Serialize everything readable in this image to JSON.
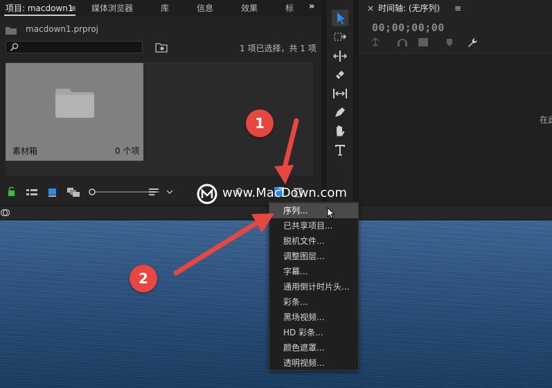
{
  "project_panel": {
    "tabs": [
      {
        "label": "项目: macdown1",
        "active": true
      },
      {
        "label": "媒体浏览器"
      },
      {
        "label": "库"
      },
      {
        "label": "信息"
      },
      {
        "label": "效果"
      },
      {
        "label": "标"
      }
    ],
    "tab_menu_glyph": "≡",
    "overflow_glyph": "»",
    "project_file": "macdown1.prproj",
    "search": {
      "value": "",
      "placeholder": ""
    },
    "selection_status": "1 项已选择，共 1 项",
    "bin": {
      "name": "素材箱",
      "count": "0 个项"
    }
  },
  "timeline_panel": {
    "close_glyph": "×",
    "title": "时间轴: (无序列)",
    "menu_glyph": "≡",
    "timecode": "00;00;00;00",
    "drop_hint": "在此"
  },
  "new_item_menu": {
    "items": [
      {
        "label": "序列...",
        "highlighted": true
      },
      {
        "label": "已共享项目..."
      },
      {
        "label": "脱机文件..."
      },
      {
        "label": "调整图层..."
      },
      {
        "label": "字幕..."
      },
      {
        "label": "通用倒计时片头..."
      },
      {
        "label": "彩条..."
      },
      {
        "label": "黑场视频..."
      },
      {
        "label": "HD 彩条..."
      },
      {
        "label": "颜色遮罩..."
      },
      {
        "label": "透明视频..."
      }
    ]
  },
  "annotations": {
    "badge_1": "1",
    "badge_2": "2",
    "watermark": "www.MacDown.com"
  },
  "colors": {
    "accent_blue": "#2d8ceb",
    "badge_red": "#e8473f",
    "lock_green": "#3bbf3b"
  },
  "icons": [
    "search-icon",
    "new-bin-icon",
    "folder-icon",
    "lock-icon",
    "list-view-icon",
    "icon-view-icon",
    "freeform-view-icon",
    "zoom-slider",
    "sort-icon",
    "find-icon",
    "new-item-icon",
    "delete-icon",
    "selection-tool-icon",
    "track-select-icon",
    "ripple-edit-icon",
    "razor-icon",
    "slip-icon",
    "pen-icon",
    "hand-icon",
    "type-icon",
    "wrench-icon"
  ]
}
